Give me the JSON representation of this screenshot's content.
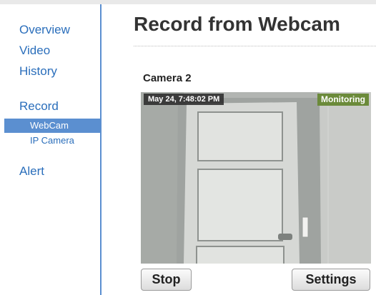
{
  "sidebar": {
    "items": [
      {
        "label": "Overview"
      },
      {
        "label": "Video"
      },
      {
        "label": "History"
      },
      {
        "label": "Record"
      },
      {
        "label": "WebCam"
      },
      {
        "label": "IP Camera"
      },
      {
        "label": "Alert"
      }
    ]
  },
  "main": {
    "title": "Record from Webcam",
    "camera_name": "Camera 2",
    "video": {
      "timestamp": "May 24, 7:48:02 PM",
      "status": "Monitoring"
    },
    "buttons": {
      "stop": "Stop",
      "settings": "Settings"
    }
  },
  "colors": {
    "accent": "#5b8fd0",
    "link": "#2a6ebb",
    "monitoring_badge": "#6b8a3a"
  }
}
